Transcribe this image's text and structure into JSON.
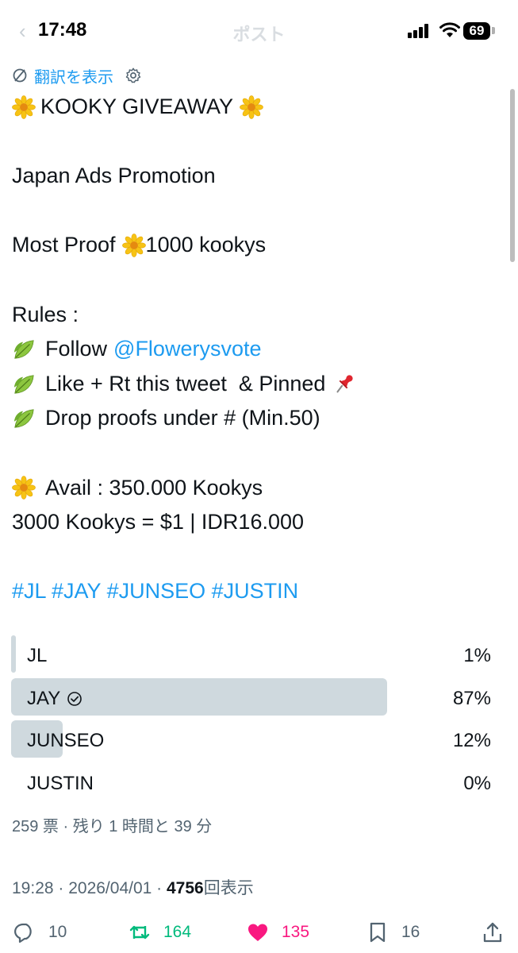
{
  "status": {
    "time": "17:48",
    "nav_title": "ポスト",
    "battery": "69"
  },
  "translate": {
    "label": "翻訳を表示",
    "icon": "translate-icon"
  },
  "tweet": {
    "lines": {
      "title": "KOOKY GIVEAWAY",
      "promo": "Japan Ads Promotion",
      "proof_prefix": "Most Proof",
      "proof_amount": "1000 kookys",
      "rules_header": "Rules :",
      "rule1_prefix": "Follow",
      "rule1_mention": "@Flowerysvote",
      "rule2": "Like + Rt this tweet  & Pinned",
      "rule3": "Drop proofs under # (Min.50)",
      "avail": "Avail : 350.000 Kookys",
      "rate": "3000 Kookys = $1 | IDR16.000",
      "hashtags": "#JL #JAY #JUNSEO #JUSTIN"
    }
  },
  "poll": {
    "options": [
      {
        "label": "JL",
        "percent": "1%",
        "fraction": 0.01,
        "selected": false
      },
      {
        "label": "JAY",
        "percent": "87%",
        "fraction": 0.87,
        "selected": true
      },
      {
        "label": "JUNSEO",
        "percent": "12%",
        "fraction": 0.12,
        "selected": false
      },
      {
        "label": "JUSTIN",
        "percent": "0%",
        "fraction": 0.0,
        "selected": false
      }
    ],
    "meta": "259 票 · 残り 1 時間と 39 分"
  },
  "timestamp": {
    "datetime": "19:28 · 2026/04/01 · ",
    "views_count": "4756",
    "views_suffix": "回表示"
  },
  "actions": {
    "replies": "10",
    "reposts": "164",
    "likes": "135",
    "bookmarks": "16"
  },
  "colors": {
    "link": "#1d9bf0",
    "repost": "#00ba7c",
    "like": "#f91880",
    "poll_bar": "#cfd9de",
    "muted": "#536471"
  }
}
